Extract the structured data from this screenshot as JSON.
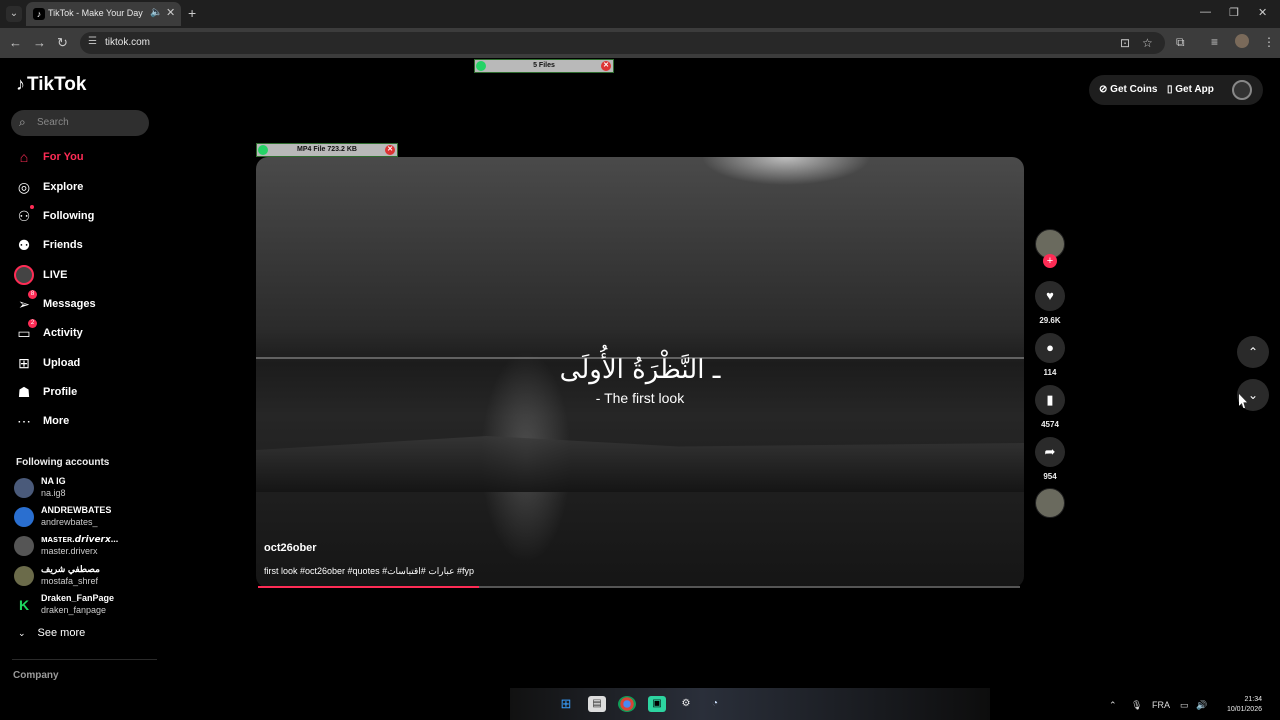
{
  "browser": {
    "tab_title": "TikTok - Make Your Day",
    "url": "tiktok.com"
  },
  "downloads": {
    "top": "5 Files",
    "video": "MP4 File 723.2 KB"
  },
  "sidebar": {
    "logo": "TikTok",
    "search_placeholder": "Search",
    "nav": [
      {
        "label": "For You",
        "icon": "home-icon"
      },
      {
        "label": "Explore",
        "icon": "compass-icon"
      },
      {
        "label": "Following",
        "icon": "user-follow-icon"
      },
      {
        "label": "Friends",
        "icon": "friends-icon"
      },
      {
        "label": "LIVE",
        "icon": "live-icon"
      },
      {
        "label": "Messages",
        "icon": "paper-plane-icon",
        "badge": "8"
      },
      {
        "label": "Activity",
        "icon": "activity-icon",
        "badge": "2"
      },
      {
        "label": "Upload",
        "icon": "plus-square-icon"
      },
      {
        "label": "Profile",
        "icon": "profile-icon"
      },
      {
        "label": "More",
        "icon": "more-icon"
      }
    ],
    "following_title": "Following accounts",
    "accounts": [
      {
        "name": "NA IG",
        "handle": "na.ig8"
      },
      {
        "name": "ANDREWBATES",
        "handle": "andrewbates_"
      },
      {
        "name": "ᴍᴀsᴛᴇʀ.𝙙𝙧𝙞𝙫𝙚𝙧𝙭...",
        "handle": "master.driverx"
      },
      {
        "name": "مصطفي شريف",
        "handle": "mostafa_shref"
      },
      {
        "name": "Draken_FanPage",
        "handle": "draken_fanpage"
      }
    ],
    "see_more": "See more",
    "company": "Company"
  },
  "header": {
    "get_coins": "Get Coins",
    "get_app": "Get App"
  },
  "video": {
    "overlay_ar": "ـ النَّظْرَةُ الأُولَى",
    "overlay_en": "- The first look",
    "author": "oct26ober",
    "caption": "first look #oct26ober #quotes #عبارات #اقتباسات #fyp",
    "progress": 0.29
  },
  "actions": {
    "likes": "29.6K",
    "comments": "114",
    "saves": "4574",
    "shares": "954"
  },
  "taskbar": {
    "lang": "FRA",
    "time": "21:34",
    "date": "10/01/2026"
  },
  "colors": {
    "accent": "#fe2c55",
    "background": "#000000"
  }
}
